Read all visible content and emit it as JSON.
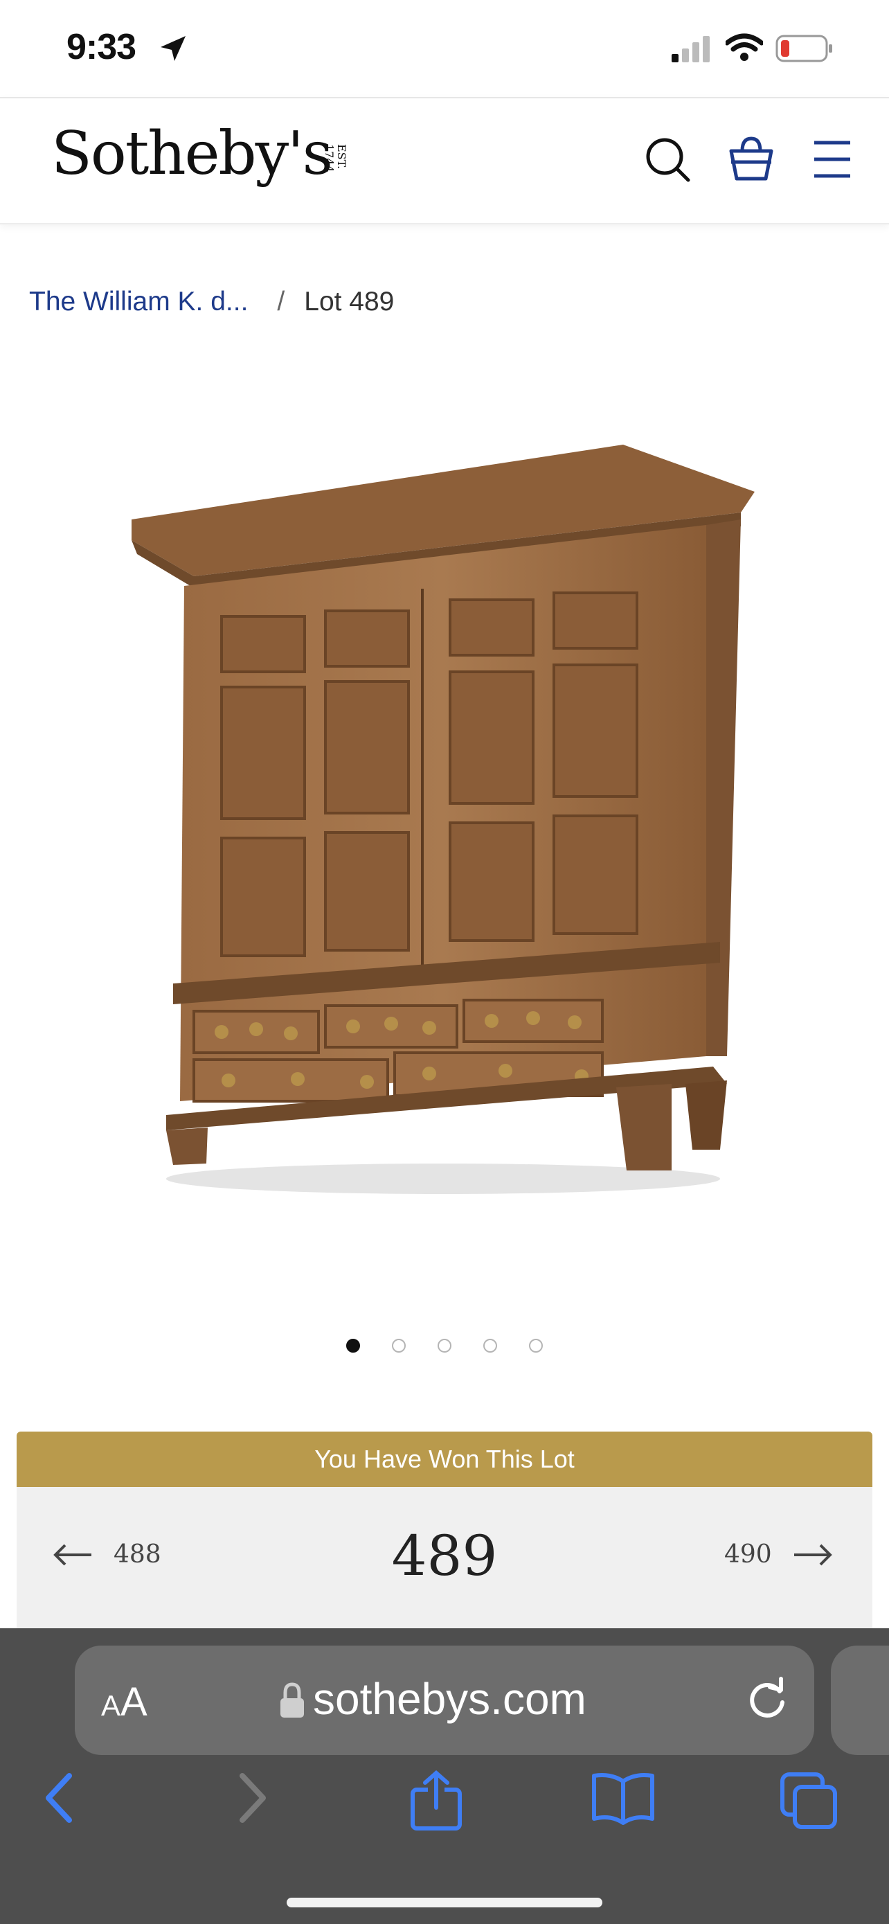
{
  "status_bar": {
    "time": "9:33"
  },
  "header": {
    "logo": "Sotheby's",
    "logo_est": "EST. 1744",
    "icons": [
      "search-icon",
      "shopping-bag-icon",
      "hamburger-menu-icon"
    ]
  },
  "breadcrumb": {
    "parent": "The William K. d...",
    "separator": "/",
    "current": "Lot 489"
  },
  "gallery": {
    "total_images": 5,
    "active_index": 1
  },
  "lot_status": {
    "banner": "You Have Won This Lot",
    "accent_color": "#b99a4c"
  },
  "lot_nav": {
    "previous": "488",
    "current": "489",
    "next": "490"
  },
  "browser": {
    "reader_label_small": "A",
    "reader_label_large": "A",
    "url": "sothebys.com",
    "toolbar_icons": [
      "back-icon",
      "forward-icon",
      "share-icon",
      "bookmarks-icon",
      "tabs-icon"
    ]
  }
}
